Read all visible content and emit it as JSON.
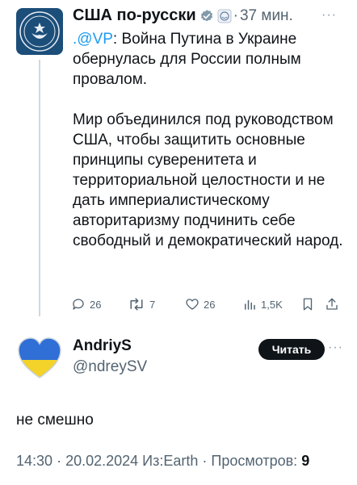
{
  "quoted_tweet": {
    "author_name": "США по-русски",
    "time_ago": "37 мин.",
    "separator": "·",
    "more": "···",
    "mention": ".@VP",
    "paragraph1_rest": ": Война Путина в Украине обернулась для России полным провалом.",
    "paragraph2": "Мир объединился под руководством США, чтобы защитить основные принципы суверенитета и территориальной целостности и не дать империалистическому авторитаризму подчинить себе свободный и демократический народ.",
    "stats": {
      "replies": "26",
      "reposts": "7",
      "likes": "26",
      "views": "1,5K"
    }
  },
  "reply": {
    "author_name": "AndriyS",
    "handle": "@ndreySV",
    "follow_label": "Читать",
    "more": "···",
    "text": "не смешно",
    "time": "14:30",
    "date": "20.02.2024",
    "source": "Из:Earth",
    "views_label": "Просмотров:",
    "views_count": "9"
  },
  "colors": {
    "accent": "#1d9bf0",
    "secondary_text": "#536471",
    "primary_text": "#0f1419",
    "ukraine_blue": "#2f6fd6",
    "ukraine_yellow": "#f3d22a"
  },
  "icons": [
    "embassy-seal-icon",
    "verified-badge-icon",
    "flag-seal-icon",
    "reply-icon",
    "repost-icon",
    "like-icon",
    "views-icon",
    "bookmark-icon",
    "share-icon",
    "ukraine-heart-icon"
  ]
}
